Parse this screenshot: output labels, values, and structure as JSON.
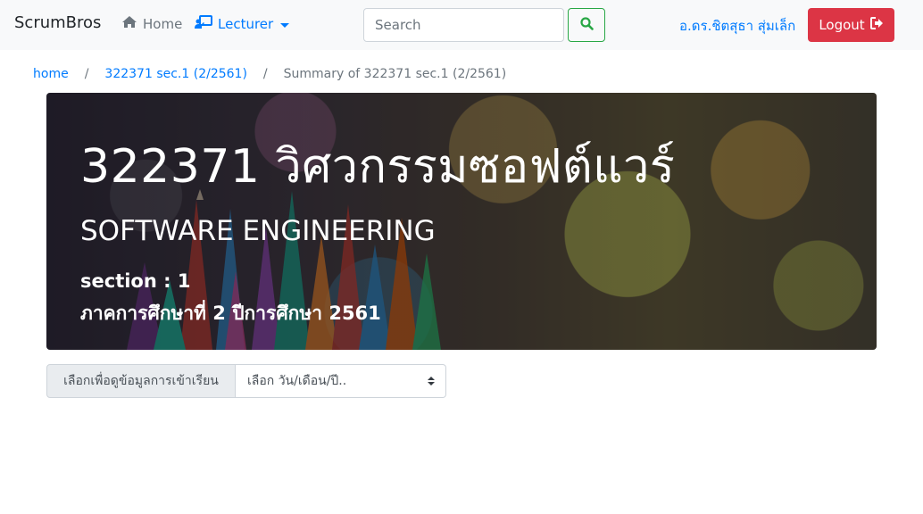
{
  "navbar": {
    "brand": "ScrumBros",
    "home_label": "Home",
    "lecturer_label": "Lecturer",
    "search_placeholder": "Search",
    "user_name": "อ.ดร.ชิตสุธา สุ่มเล็ก",
    "logout_label": "Logout"
  },
  "breadcrumb": {
    "items": [
      "home",
      "322371 sec.1 (2/2561)",
      "Summary of 322371 sec.1 (2/2561)"
    ],
    "separator": "/"
  },
  "jumbotron": {
    "title": "322371 วิศวกรรมซอฟต์แวร์",
    "subtitle": "SOFTWARE ENGINEERING",
    "section": "section : 1",
    "term": "ภาคการศึกษาที่ 2 ปีการศึกษา 2561"
  },
  "attendance": {
    "label": "เลือกเพื่อดูข้อมูลการเข้าเรียน",
    "select_value": "เลือก วัน/เดือน/ปี.."
  },
  "colors": {
    "primary": "#007bff",
    "danger": "#dc3545",
    "success": "#28a745",
    "navbar_bg": "#f8f9fa"
  },
  "icons": {
    "home": "home-icon",
    "lecturer": "chalkboard-teacher-icon",
    "search": "search-icon",
    "logout": "sign-out-icon"
  }
}
